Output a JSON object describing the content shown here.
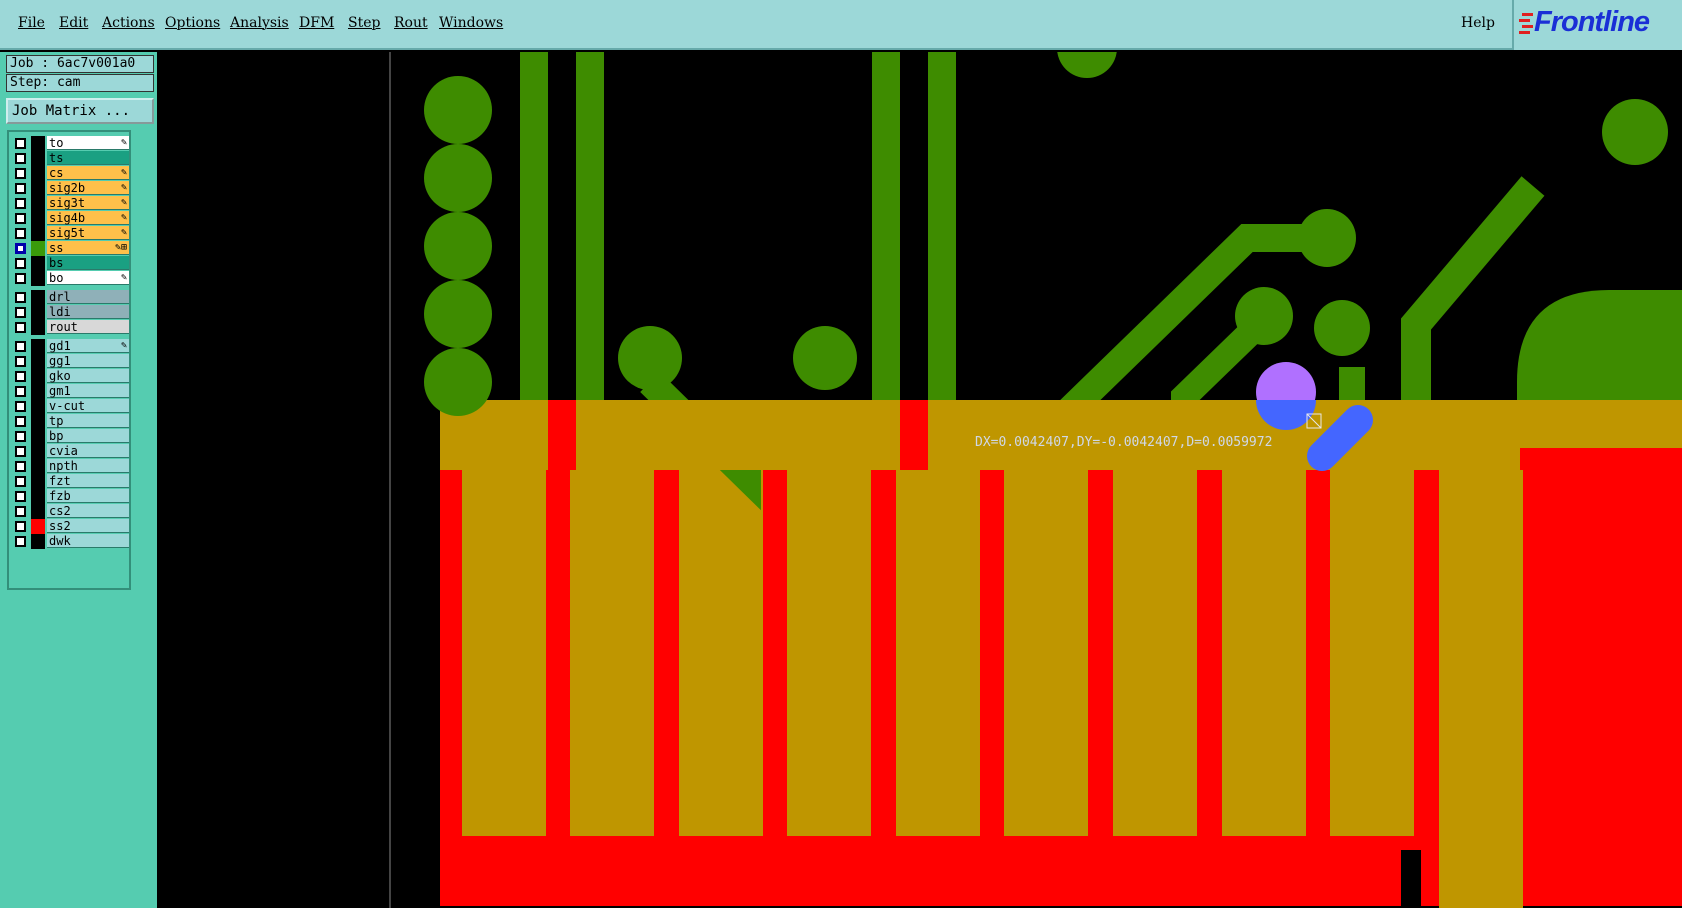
{
  "menu": {
    "items": [
      "File",
      "Edit",
      "Actions",
      "Options",
      "Analysis",
      "DFM",
      "Step",
      "Rout",
      "Windows"
    ],
    "help": "Help"
  },
  "logo": {
    "text": "Frontline"
  },
  "job": {
    "label": "Job : 6ac7v001a0"
  },
  "step": {
    "label": "Step: cam"
  },
  "job_matrix": {
    "label": "Job Matrix ..."
  },
  "layers_group1": [
    {
      "name": "to",
      "color": "#ffffff",
      "swatch": "#000000",
      "active": false,
      "flag": "✎"
    },
    {
      "name": "ts",
      "color": "#1aa082",
      "swatch": "#000000",
      "active": false,
      "flag": ""
    },
    {
      "name": "cs",
      "color": "#ffc04a",
      "swatch": "#000000",
      "active": false,
      "flag": "✎"
    },
    {
      "name": "sig2b",
      "color": "#ffc04a",
      "swatch": "#000000",
      "active": false,
      "flag": "✎"
    },
    {
      "name": "sig3t",
      "color": "#ffc04a",
      "swatch": "#000000",
      "active": false,
      "flag": "✎"
    },
    {
      "name": "sig4b",
      "color": "#ffc04a",
      "swatch": "#000000",
      "active": false,
      "flag": "✎"
    },
    {
      "name": "sig5t",
      "color": "#ffc04a",
      "swatch": "#000000",
      "active": false,
      "flag": "✎"
    },
    {
      "name": "ss",
      "color": "#ffc04a",
      "swatch": "#3a9a0a",
      "active": true,
      "flag": "✎⊞"
    },
    {
      "name": "bs",
      "color": "#1aa082",
      "swatch": "#000000",
      "active": false,
      "flag": ""
    },
    {
      "name": "bo",
      "color": "#ffffff",
      "swatch": "#000000",
      "active": false,
      "flag": "✎"
    }
  ],
  "layers_group2": [
    {
      "name": "drl",
      "color": "#8fb0b8",
      "swatch": "#000000",
      "active": false,
      "flag": ""
    },
    {
      "name": "ldi",
      "color": "#8fb0b8",
      "swatch": "#000000",
      "active": false,
      "flag": ""
    },
    {
      "name": "rout",
      "color": "#d8d8d8",
      "swatch": "#000000",
      "active": false,
      "flag": ""
    }
  ],
  "layers_group3": [
    {
      "name": "gd1",
      "color": "#9cd8d8",
      "swatch": "#000000",
      "active": false,
      "flag": "✎"
    },
    {
      "name": "gg1",
      "color": "#9cd8d8",
      "swatch": "#000000",
      "active": false,
      "flag": ""
    },
    {
      "name": "gko",
      "color": "#9cd8d8",
      "swatch": "#000000",
      "active": false,
      "flag": ""
    },
    {
      "name": "gm1",
      "color": "#9cd8d8",
      "swatch": "#000000",
      "active": false,
      "flag": ""
    },
    {
      "name": "v-cut",
      "color": "#9cd8d8",
      "swatch": "#000000",
      "active": false,
      "flag": ""
    },
    {
      "name": "tp",
      "color": "#9cd8d8",
      "swatch": "#000000",
      "active": false,
      "flag": ""
    },
    {
      "name": "bp",
      "color": "#9cd8d8",
      "swatch": "#000000",
      "active": false,
      "flag": ""
    },
    {
      "name": "cvia",
      "color": "#9cd8d8",
      "swatch": "#000000",
      "active": false,
      "flag": ""
    },
    {
      "name": "npth",
      "color": "#9cd8d8",
      "swatch": "#000000",
      "active": false,
      "flag": ""
    },
    {
      "name": "fzt",
      "color": "#9cd8d8",
      "swatch": "#000000",
      "active": false,
      "flag": ""
    },
    {
      "name": "fzb",
      "color": "#9cd8d8",
      "swatch": "#000000",
      "active": false,
      "flag": ""
    },
    {
      "name": "cs2",
      "color": "#9cd8d8",
      "swatch": "#000000",
      "active": false,
      "flag": ""
    },
    {
      "name": "ss2",
      "color": "#9cd8d8",
      "swatch": "#ff0000",
      "active": false,
      "flag": ""
    },
    {
      "name": "dwk",
      "color": "#9cd8d8",
      "swatch": "#000000",
      "active": false,
      "flag": ""
    }
  ],
  "measure": {
    "text": "DX=0.0042407,DY=-0.0042407,D=0.0059972"
  },
  "colors": {
    "trace_green": "#3e8c00",
    "solder_red": "#ff0000",
    "overlap_gold": "#bf9600",
    "highlight_violet": "#b070ff",
    "measure_blue": "#4466ff"
  }
}
